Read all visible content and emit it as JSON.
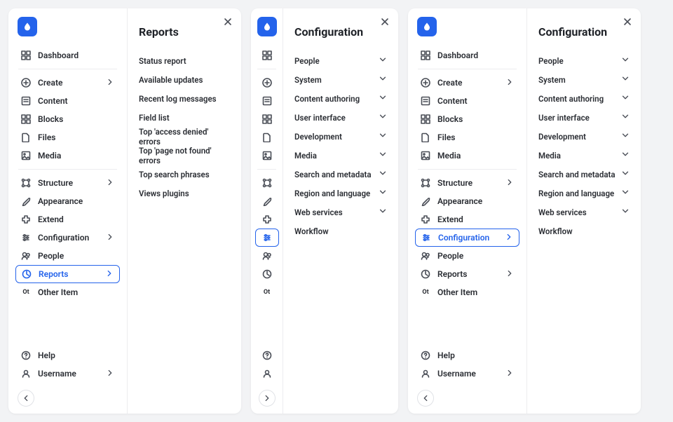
{
  "nav": {
    "dashboard": "Dashboard",
    "create": "Create",
    "content": "Content",
    "blocks": "Blocks",
    "files": "Files",
    "media": "Media",
    "structure": "Structure",
    "appearance": "Appearance",
    "extend": "Extend",
    "configuration": "Configuration",
    "people": "People",
    "reports": "Reports",
    "other_item": "Other Item",
    "other_abbrev": "Ot",
    "help": "Help",
    "username": "Username"
  },
  "reports_panel": {
    "title": "Reports",
    "items": [
      "Status report",
      "Available updates",
      "Recent log messages",
      "Field list",
      "Top 'access denied' errors",
      "Top 'page not found' errors",
      "Top search phrases",
      "Views plugins"
    ]
  },
  "config_panel": {
    "title": "Configuration",
    "items": [
      {
        "label": "People",
        "expandable": true
      },
      {
        "label": "System",
        "expandable": true
      },
      {
        "label": "Content authoring",
        "expandable": true
      },
      {
        "label": "User interface",
        "expandable": true
      },
      {
        "label": "Development",
        "expandable": true
      },
      {
        "label": "Media",
        "expandable": true
      },
      {
        "label": "Search and metadata",
        "expandable": true
      },
      {
        "label": "Region and language",
        "expandable": true
      },
      {
        "label": "Web services",
        "expandable": true
      },
      {
        "label": "Workflow",
        "expandable": false
      }
    ]
  }
}
